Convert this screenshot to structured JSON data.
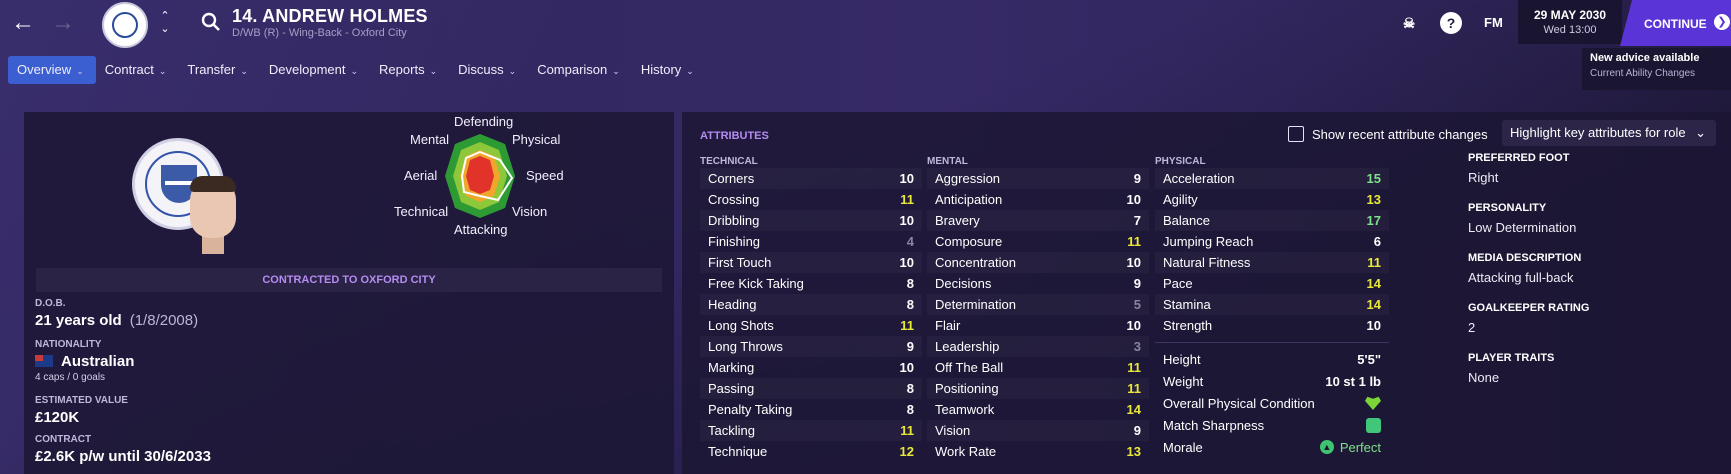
{
  "header": {
    "player_title": "14. ANDREW HOLMES",
    "player_subtitle": "D/WB (R) - Wing-Back - Oxford City",
    "fm_label": "FM",
    "date": "29 MAY 2030",
    "time": "Wed 13:00",
    "continue_label": "CONTINUE"
  },
  "menu": [
    {
      "label": "Overview",
      "active": true
    },
    {
      "label": "Contract"
    },
    {
      "label": "Transfer"
    },
    {
      "label": "Development"
    },
    {
      "label": "Reports"
    },
    {
      "label": "Discuss"
    },
    {
      "label": "Comparison"
    },
    {
      "label": "History"
    }
  ],
  "advice": {
    "title": "New advice available",
    "subtitle": "Current Ability Changes"
  },
  "profile": {
    "radar_labels": {
      "defending": "Defending",
      "physical": "Physical",
      "speed": "Speed",
      "vision": "Vision",
      "attacking": "Attacking",
      "technical": "Technical",
      "aerial": "Aerial",
      "mental": "Mental"
    },
    "contract_strip": "CONTRACTED TO OXFORD CITY",
    "dob_label": "D.O.B.",
    "age": "21 years old",
    "dob": "(1/8/2008)",
    "nationality_label": "NATIONALITY",
    "nationality": "Australian",
    "caps": "4 caps / 0 goals",
    "value_label": "ESTIMATED VALUE",
    "value": "£120K",
    "contract_label": "CONTRACT",
    "contract": "£2.6K p/w until 30/6/2033"
  },
  "attributes": {
    "title": "ATTRIBUTES",
    "show_changes": "Show recent attribute changes",
    "highlight": "Highlight key attributes for role",
    "technical_head": "TECHNICAL",
    "mental_head": "MENTAL",
    "physical_head": "PHYSICAL",
    "technical": [
      {
        "name": "Corners",
        "value": "10"
      },
      {
        "name": "Crossing",
        "value": "11"
      },
      {
        "name": "Dribbling",
        "value": "10"
      },
      {
        "name": "Finishing",
        "value": "4"
      },
      {
        "name": "First Touch",
        "value": "10"
      },
      {
        "name": "Free Kick Taking",
        "value": "8"
      },
      {
        "name": "Heading",
        "value": "8"
      },
      {
        "name": "Long Shots",
        "value": "11"
      },
      {
        "name": "Long Throws",
        "value": "9"
      },
      {
        "name": "Marking",
        "value": "10"
      },
      {
        "name": "Passing",
        "value": "8"
      },
      {
        "name": "Penalty Taking",
        "value": "8"
      },
      {
        "name": "Tackling",
        "value": "11"
      },
      {
        "name": "Technique",
        "value": "12"
      }
    ],
    "mental": [
      {
        "name": "Aggression",
        "value": "9"
      },
      {
        "name": "Anticipation",
        "value": "10"
      },
      {
        "name": "Bravery",
        "value": "7"
      },
      {
        "name": "Composure",
        "value": "11"
      },
      {
        "name": "Concentration",
        "value": "10"
      },
      {
        "name": "Decisions",
        "value": "9"
      },
      {
        "name": "Determination",
        "value": "5"
      },
      {
        "name": "Flair",
        "value": "10"
      },
      {
        "name": "Leadership",
        "value": "3"
      },
      {
        "name": "Off The Ball",
        "value": "11"
      },
      {
        "name": "Positioning",
        "value": "11"
      },
      {
        "name": "Teamwork",
        "value": "14"
      },
      {
        "name": "Vision",
        "value": "9"
      },
      {
        "name": "Work Rate",
        "value": "13"
      }
    ],
    "physical": [
      {
        "name": "Acceleration",
        "value": "15"
      },
      {
        "name": "Agility",
        "value": "13"
      },
      {
        "name": "Balance",
        "value": "17"
      },
      {
        "name": "Jumping Reach",
        "value": "6"
      },
      {
        "name": "Natural Fitness",
        "value": "11"
      },
      {
        "name": "Pace",
        "value": "14"
      },
      {
        "name": "Stamina",
        "value": "14"
      },
      {
        "name": "Strength",
        "value": "10"
      }
    ],
    "physical_extra": {
      "height_label": "Height",
      "height": "5'5\"",
      "weight_label": "Weight",
      "weight": "10 st 1 lb",
      "condition_label": "Overall Physical Condition",
      "sharpness_label": "Match Sharpness",
      "morale_label": "Morale",
      "morale": "Perfect"
    }
  },
  "side_info": {
    "foot_label": "PREFERRED FOOT",
    "foot": "Right",
    "personality_label": "PERSONALITY",
    "personality": "Low Determination",
    "media_label": "MEDIA DESCRIPTION",
    "media": "Attacking full-back",
    "gk_label": "GOALKEEPER RATING",
    "gk": "2",
    "traits_label": "PLAYER TRAITS",
    "traits": "None"
  },
  "colors": {
    "accent": "#5a34d6",
    "menu_active": "#3b5fd1",
    "section_title": "#b48cf0",
    "value_low": "#8a849f",
    "value_mid": "#ffffff",
    "value_good": "#e8e83a",
    "value_high": "#7ee08a"
  }
}
